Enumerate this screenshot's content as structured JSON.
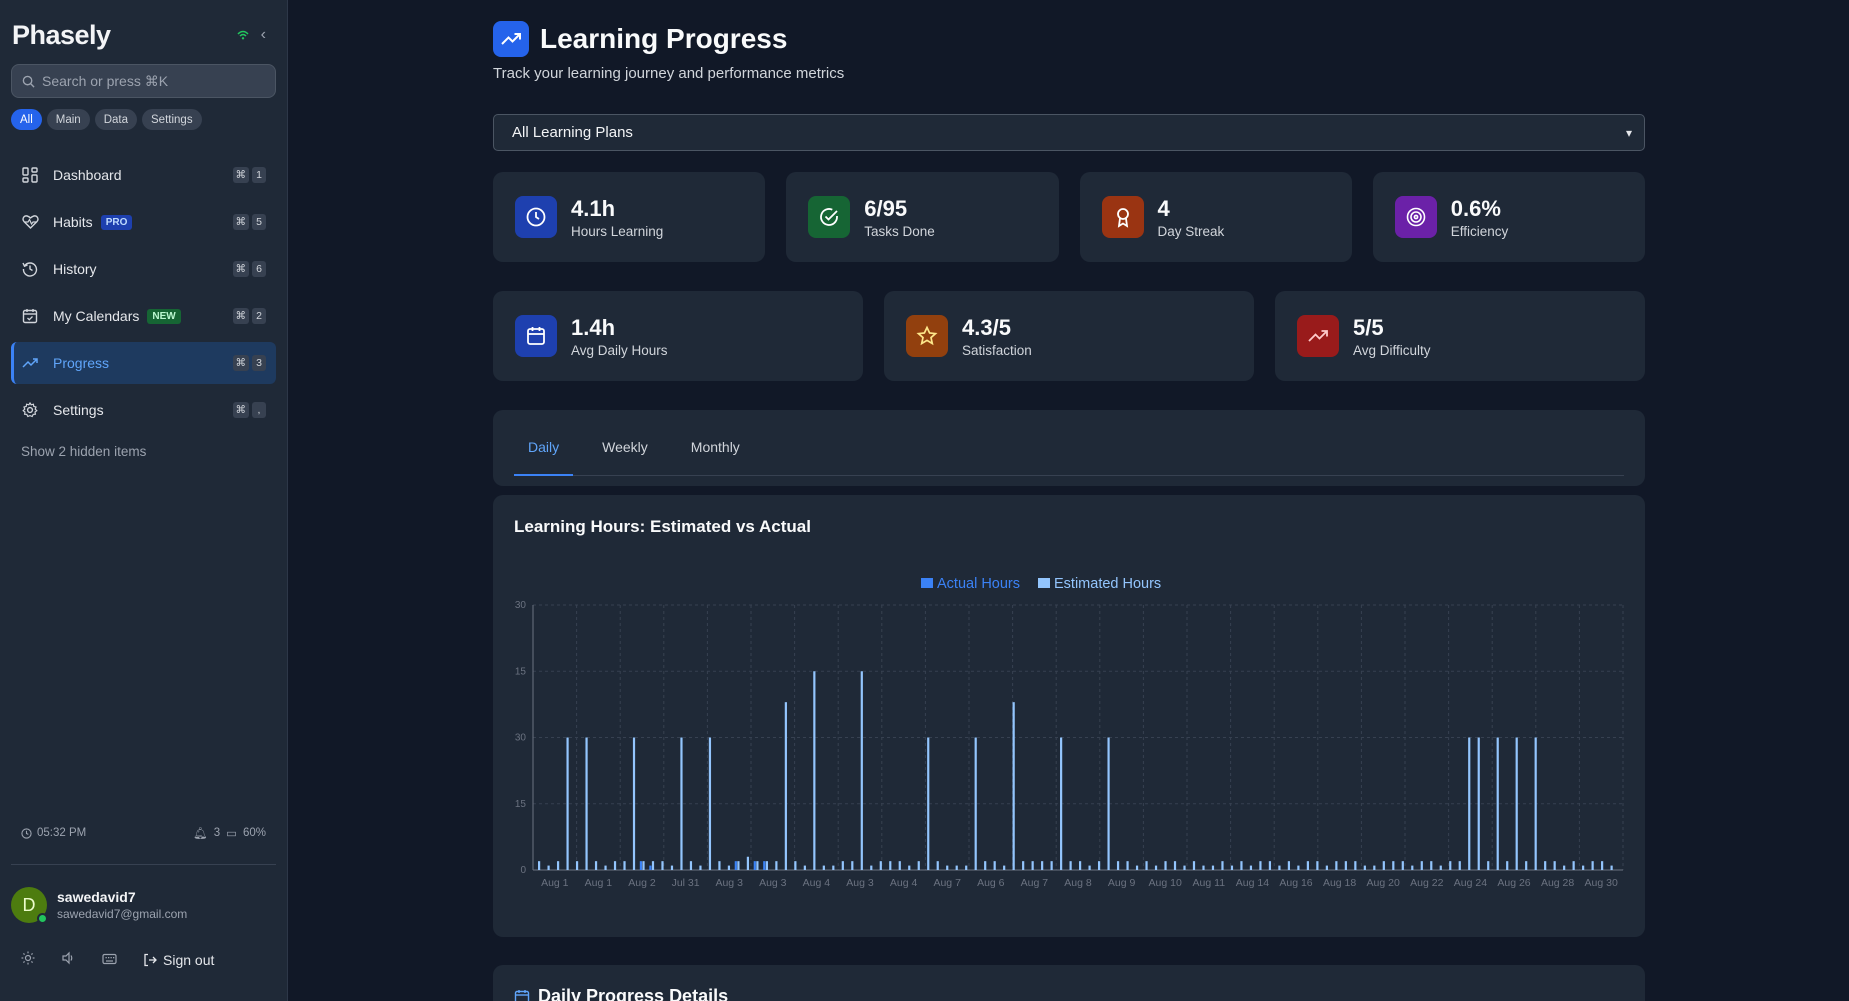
{
  "sidebar": {
    "logo": "Phasely",
    "search_placeholder": "Search or press ⌘K",
    "filters": [
      "All",
      "Main",
      "Data",
      "Settings"
    ],
    "nav": [
      {
        "label": "Dashboard",
        "key": "1",
        "badge": ""
      },
      {
        "label": "Habits",
        "key": "5",
        "badge": "PRO"
      },
      {
        "label": "History",
        "key": "6",
        "badge": ""
      },
      {
        "label": "My Calendars",
        "key": "2",
        "badge": "NEW"
      },
      {
        "label": "Progress",
        "key": "3",
        "badge": ""
      },
      {
        "label": "Settings",
        "key": ",",
        "badge": ""
      }
    ],
    "kbd_symbol": "⌘",
    "hidden_items": "Show 2 hidden items",
    "time": "05:32 PM",
    "notifications": "3",
    "battery": "60%",
    "user_name": "sawedavid7",
    "user_email": "sawedavid7@gmail.com",
    "avatar_letter": "D",
    "sign_out": "Sign out"
  },
  "header": {
    "title": "Learning Progress",
    "subtitle": "Track your learning journey and performance metrics",
    "plan_select": "All Learning Plans"
  },
  "stats_row1": [
    {
      "value": "4.1h",
      "label": "Hours Learning",
      "icon": "clock-icon",
      "color": "#1e40af"
    },
    {
      "value": "6/95",
      "label": "Tasks Done",
      "icon": "check-circle-icon",
      "color": "#166534"
    },
    {
      "value": "4",
      "label": "Day Streak",
      "icon": "award-icon",
      "color": "#9a3412"
    },
    {
      "value": "0.6%",
      "label": "Efficiency",
      "icon": "target-icon",
      "color": "#6b21a8"
    }
  ],
  "stats_row2": [
    {
      "value": "1.4h",
      "label": "Avg Daily Hours",
      "icon": "calendar-icon",
      "color": "#1e40af"
    },
    {
      "value": "4.3/5",
      "label": "Satisfaction",
      "icon": "star-icon",
      "color": "#92400e"
    },
    {
      "value": "5/5",
      "label": "Avg Difficulty",
      "icon": "trending-up-icon",
      "color": "#991b1b"
    }
  ],
  "tabs": [
    "Daily",
    "Weekly",
    "Monthly"
  ],
  "chart_title": "Learning Hours: Estimated vs Actual",
  "details_title": "Daily Progress Details",
  "chart_data": {
    "type": "bar",
    "title": "Learning Hours: Estimated vs Actual",
    "y_ticks": [
      "0",
      "15",
      "30",
      "15",
      "30"
    ],
    "ylim": [
      0,
      60
    ],
    "grid": true,
    "legend_placement": "top-center",
    "series": [
      {
        "name": "Actual Hours",
        "color": "#3b82f6"
      },
      {
        "name": "Estimated Hours",
        "color": "#93c5fd"
      }
    ],
    "x_labels": [
      "Aug 1",
      "Aug 1",
      "Aug 2",
      "Jul 31",
      "Aug 3",
      "Aug 3",
      "Aug 4",
      "Aug 3",
      "Aug 4",
      "Aug 7",
      "Aug 6",
      "Aug 7",
      "Aug 8",
      "Aug 9",
      "Aug 10",
      "Aug 11",
      "Aug 14",
      "Aug 16",
      "Aug 18",
      "Aug 20",
      "Aug 22",
      "Aug 24",
      "Aug 26",
      "Aug 28",
      "Aug 30"
    ],
    "estimated_values": [
      2,
      1,
      2,
      30,
      2,
      30,
      2,
      1,
      2,
      2,
      30,
      2,
      2,
      2,
      1,
      30,
      2,
      1,
      30,
      2,
      1,
      2,
      3,
      2,
      2,
      2,
      38,
      2,
      1,
      45,
      1,
      1,
      2,
      2,
      45,
      1,
      2,
      2,
      2,
      1,
      2,
      30,
      2,
      1,
      1,
      1,
      30,
      2,
      2,
      1,
      38,
      2,
      2,
      2,
      2,
      30,
      2,
      2,
      1,
      2,
      30,
      2,
      2,
      1,
      2,
      1,
      2,
      2,
      1,
      2,
      1,
      1,
      2,
      1,
      2,
      1,
      2,
      2,
      1,
      2,
      1,
      2,
      2,
      1,
      2,
      2,
      2,
      1,
      1,
      2,
      2,
      2,
      1,
      2,
      2,
      1,
      2,
      2,
      30,
      30,
      2,
      30,
      2,
      30,
      2,
      30,
      2,
      2,
      1,
      2,
      1,
      2,
      2,
      1
    ],
    "actual_values": [
      0,
      0,
      0,
      0,
      0,
      0,
      0,
      0,
      0,
      0,
      0,
      2,
      1,
      0,
      0,
      0,
      0,
      0,
      0,
      0,
      0,
      2,
      0,
      2,
      2,
      0,
      0,
      0,
      0,
      0,
      0,
      0,
      0,
      0,
      0,
      0,
      0,
      0,
      0,
      0,
      0,
      0,
      0,
      0,
      0,
      0,
      0,
      0,
      0,
      0,
      0,
      0,
      0,
      0,
      0,
      0,
      0,
      0,
      0,
      0,
      0,
      0,
      0,
      0,
      0,
      0,
      0,
      0,
      0,
      0,
      0,
      0,
      0,
      0,
      0,
      0,
      0,
      0,
      0,
      0,
      0,
      0,
      0,
      0,
      0,
      0,
      0,
      0,
      0,
      0,
      0,
      0,
      0,
      0,
      0,
      0,
      0,
      0,
      0,
      0,
      0,
      0,
      0,
      0,
      0,
      0,
      0,
      0,
      0,
      0,
      0,
      0,
      0,
      0,
      0
    ]
  },
  "colors": {
    "accent": "#3b82f6",
    "background": "#111827",
    "card": "#1f2937"
  }
}
